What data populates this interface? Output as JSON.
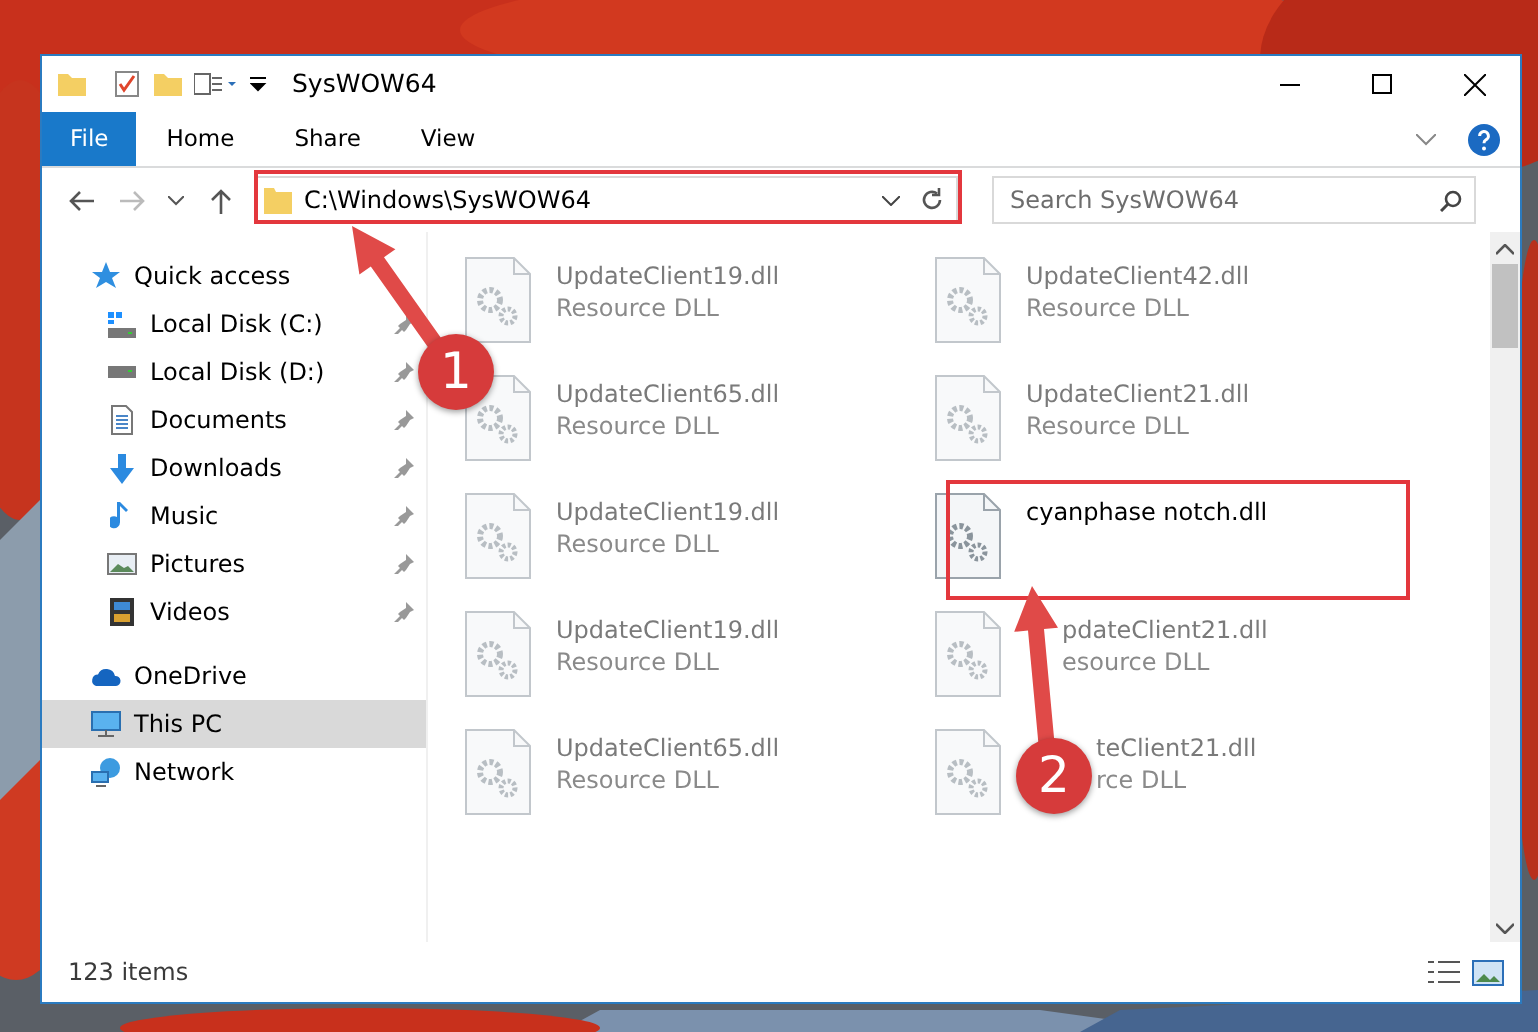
{
  "window": {
    "title": "SysWOW64"
  },
  "ribbon_tabs": [
    {
      "label": "File",
      "kind": "file",
      "selected": false
    },
    {
      "label": "Home",
      "kind": "tab",
      "selected": false
    },
    {
      "label": "Share",
      "kind": "tab",
      "selected": false
    },
    {
      "label": "View",
      "kind": "tab",
      "selected": false
    }
  ],
  "address": {
    "path": "C:\\Windows\\SysWOW64"
  },
  "search": {
    "placeholder": "Search SysWOW64"
  },
  "navigation": [
    {
      "label": "Quick access",
      "selected": false,
      "children": [
        {
          "label": "Local Disk (C:)",
          "pinned": true,
          "selected": false
        },
        {
          "label": "Local Disk (D:)",
          "pinned": true,
          "selected": false
        },
        {
          "label": "Documents",
          "pinned": true,
          "selected": false
        },
        {
          "label": "Downloads",
          "pinned": true,
          "selected": false
        },
        {
          "label": "Music",
          "pinned": true,
          "selected": false
        },
        {
          "label": "Pictures",
          "pinned": true,
          "selected": false
        },
        {
          "label": "Videos",
          "pinned": true,
          "selected": false
        }
      ]
    },
    {
      "label": "OneDrive",
      "selected": false
    },
    {
      "label": "This PC",
      "selected": true
    },
    {
      "label": "Network",
      "selected": false
    }
  ],
  "files": [
    {
      "name": "UpdateClient19.dll",
      "type": "Resource DLL",
      "faded": true
    },
    {
      "name": "UpdateClient42.dll",
      "type": "Resource DLL",
      "faded": true
    },
    {
      "name": "UpdateClient65.dll",
      "type": "Resource DLL",
      "faded": true
    },
    {
      "name": "UpdateClient21.dll",
      "type": "Resource DLL",
      "faded": true
    },
    {
      "name": "UpdateClient19.dll",
      "type": "Resource DLL",
      "faded": true
    },
    {
      "name": "cyanphase notch.dll",
      "faded": false
    },
    {
      "name": "UpdateClient19.dll",
      "type": "Resource DLL",
      "faded": true
    },
    {
      "name": "pdateClient21.dll",
      "type": "esource DLL",
      "faded": true
    },
    {
      "name": "UpdateClient65.dll",
      "type": "Resource DLL",
      "faded": true
    },
    {
      "name": "teClient21.dll",
      "type": "rce DLL",
      "faded": true
    }
  ],
  "annotations": [
    {
      "number": "1"
    },
    {
      "number": "2"
    }
  ],
  "status_bar": {
    "item_count": "123 items"
  }
}
